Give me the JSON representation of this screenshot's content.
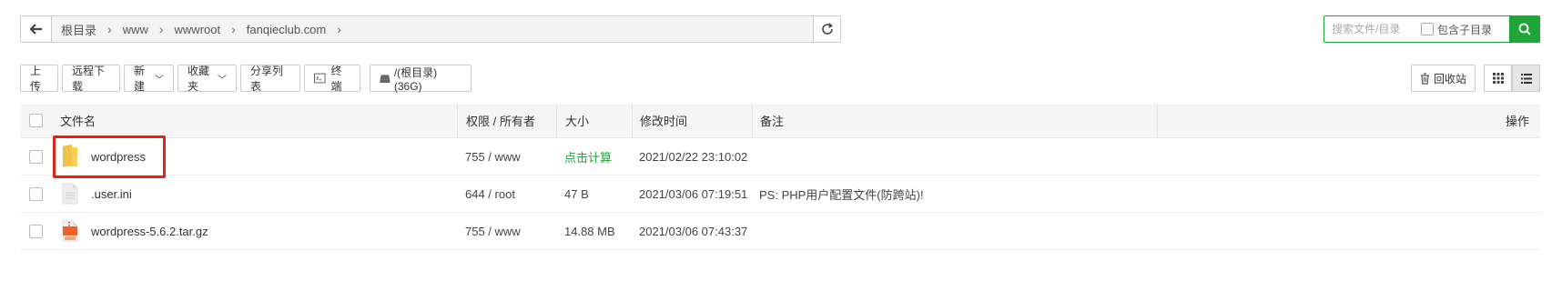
{
  "path": {
    "crumbs": [
      "根目录",
      "www",
      "wwwroot",
      "fanqieclub.com"
    ]
  },
  "search": {
    "placeholder": "搜索文件/目录",
    "include_sub_label": "包含子目录"
  },
  "toolbar": {
    "upload": "上传",
    "remote_download": "远程下载",
    "new": "新建",
    "favorites": "收藏夹",
    "share_list": "分享列表",
    "terminal": "终端",
    "disk": "/(根目录) (36G)",
    "recycle": "回收站"
  },
  "table": {
    "headers": {
      "name": "文件名",
      "perm": "权限 / 所有者",
      "size": "大小",
      "mtime": "修改时间",
      "note": "备注",
      "ops": "操作"
    },
    "rows": [
      {
        "name": "wordpress",
        "type": "folder",
        "perm": "755 / www",
        "size": "点击计算",
        "mtime": "2021/02/22 23:10:02",
        "note": ""
      },
      {
        "name": ".user.ini",
        "type": "file",
        "perm": "644 / root",
        "size": "47 B",
        "mtime": "2021/03/06 07:19:51",
        "note": "PS: PHP用户配置文件(防跨站)!"
      },
      {
        "name": "wordpress-5.6.2.tar.gz",
        "type": "archive",
        "perm": "755 / www",
        "size": "14.88 MB",
        "mtime": "2021/03/06 07:43:37",
        "note": ""
      }
    ]
  },
  "colors": {
    "accent": "#20a53a",
    "highlight": "#d9251c"
  }
}
